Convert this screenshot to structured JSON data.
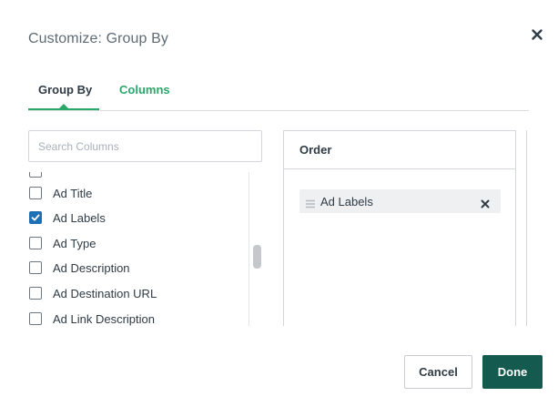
{
  "dialog": {
    "title": "Customize: Group By"
  },
  "tabs": [
    {
      "label": "Group By",
      "active": true
    },
    {
      "label": "Columns",
      "active": false
    }
  ],
  "search": {
    "placeholder": "Search Columns",
    "value": ""
  },
  "columns": [
    {
      "label": "",
      "checked": false
    },
    {
      "label": "Ad Title",
      "checked": false
    },
    {
      "label": "Ad Labels",
      "checked": true
    },
    {
      "label": "Ad Type",
      "checked": false
    },
    {
      "label": "Ad Description",
      "checked": false
    },
    {
      "label": "Ad Destination URL",
      "checked": false
    },
    {
      "label": "Ad Link Description",
      "checked": false
    }
  ],
  "order": {
    "title": "Order",
    "items": [
      {
        "label": "Ad Labels"
      }
    ]
  },
  "buttons": {
    "cancel": "Cancel",
    "done": "Done"
  },
  "colors": {
    "accent_green": "#2aa86a",
    "done_bg": "#145a4f",
    "checkbox_blue": "#1f6fb5"
  },
  "icons": {
    "close": "close-icon",
    "drag": "drag-handle-icon",
    "remove": "remove-icon",
    "check": "checkmark-icon"
  }
}
